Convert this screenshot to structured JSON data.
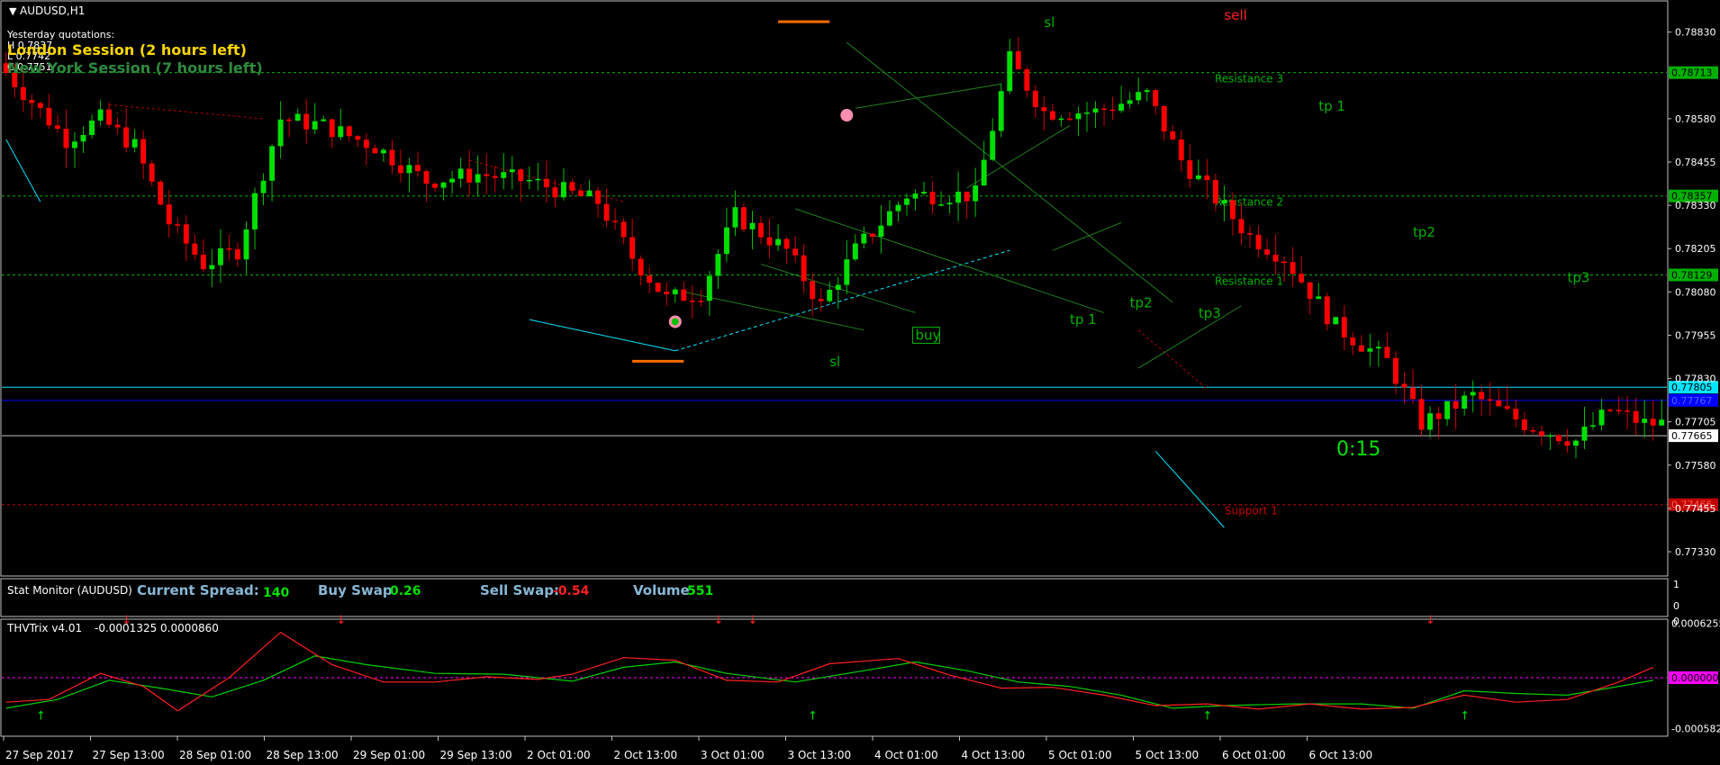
{
  "window": {
    "title": "AUDUSD,H1"
  },
  "overlay": {
    "yesterday_label": "Yesterday quotations:",
    "yesterday_lines": [
      "H 0.7837",
      "L 0.7742",
      "C 0.7751"
    ],
    "london_session": "London Session (2 hours left)",
    "newyork_session": "New York Session (7 hours left)"
  },
  "colors": {
    "background": "#000000",
    "bull": "#00e000",
    "bear": "#ff0000",
    "wick_bull": "#00c000",
    "wick_bear": "#d00000",
    "cyan": "#00e5ff",
    "blue": "#0000ff",
    "resistance": "#00b000",
    "support": "#c00000",
    "order_line": "#ff6a00",
    "gray_line": "#c0c0c0",
    "trix_main": "#00d000",
    "trix_signal": "#ff2020",
    "trix_zero": "#ff00ff",
    "stat_label": "#87b8d6"
  },
  "chart_data": [
    {
      "type": "candlestick",
      "symbol": "AUDUSD",
      "timeframe": "H1",
      "ylim": [
        0.7726,
        0.7892
      ],
      "yticks": [
        "0.78830",
        "0.78580",
        "0.78455",
        "0.78330",
        "0.78205",
        "0.78080",
        "0.77955",
        "0.77830",
        "0.77705",
        "0.77580",
        "0.77455",
        "0.77330"
      ],
      "x_labels": [
        "27 Sep 2017",
        "27 Sep 13:00",
        "28 Sep 01:00",
        "28 Sep 13:00",
        "29 Sep 01:00",
        "29 Sep 13:00",
        "2 Oct 01:00",
        "2 Oct 13:00",
        "3 Oct 01:00",
        "3 Oct 13:00",
        "4 Oct 01:00",
        "4 Oct 13:00",
        "5 Oct 01:00",
        "5 Oct 13:00",
        "6 Oct 01:00",
        "6 Oct 13:00"
      ],
      "waypoints": [
        [
          0,
          0.7874
        ],
        [
          8,
          0.7852
        ],
        [
          12,
          0.7858
        ],
        [
          16,
          0.785
        ],
        [
          20,
          0.7828
        ],
        [
          24,
          0.7816
        ],
        [
          28,
          0.782
        ],
        [
          33,
          0.7858
        ],
        [
          38,
          0.7856
        ],
        [
          44,
          0.785
        ],
        [
          50,
          0.784
        ],
        [
          56,
          0.7842
        ],
        [
          62,
          0.784
        ],
        [
          70,
          0.7834
        ],
        [
          74,
          0.7818
        ],
        [
          78,
          0.7806
        ],
        [
          82,
          0.7808
        ],
        [
          86,
          0.783
        ],
        [
          92,
          0.782
        ],
        [
          96,
          0.7804
        ],
        [
          100,
          0.782
        ],
        [
          106,
          0.7836
        ],
        [
          114,
          0.7836
        ],
        [
          118,
          0.7875
        ],
        [
          122,
          0.786
        ],
        [
          128,
          0.786
        ],
        [
          134,
          0.7865
        ],
        [
          138,
          0.7846
        ],
        [
          146,
          0.7824
        ],
        [
          150,
          0.7818
        ],
        [
          156,
          0.7798
        ],
        [
          162,
          0.7788
        ],
        [
          166,
          0.777
        ],
        [
          172,
          0.7778
        ],
        [
          178,
          0.777
        ],
        [
          184,
          0.7765
        ],
        [
          188,
          0.7774
        ],
        [
          192,
          0.777
        ]
      ],
      "price_levels": [
        {
          "label": "Resistance 3",
          "value": "0.78713",
          "price": 0.78713,
          "kind": "resistance"
        },
        {
          "label": "Resistance 2",
          "value": "0.78357",
          "price": 0.78357,
          "kind": "resistance"
        },
        {
          "label": "Resistance 1",
          "value": "0.78129",
          "price": 0.78129,
          "kind": "resistance"
        },
        {
          "label": "",
          "value": "0.77805",
          "price": 0.77805,
          "kind": "cyan"
        },
        {
          "label": "",
          "value": "0.77767",
          "price": 0.77767,
          "kind": "blue"
        },
        {
          "label": "",
          "value": "0.77665",
          "price": 0.77665,
          "kind": "current"
        },
        {
          "label": "Support 1",
          "value": "0.77466",
          "price": 0.77466,
          "kind": "support"
        }
      ],
      "annotations": [
        {
          "text": "sl",
          "bar": 96,
          "price": 0.77865,
          "color": "#00b000"
        },
        {
          "text": "buy",
          "bar": 106,
          "price": 0.77942,
          "color": "#00b000",
          "boxed": true
        },
        {
          "text": "tp 1",
          "bar": 124,
          "price": 0.77987,
          "color": "#00b000"
        },
        {
          "text": "tp2",
          "bar": 131,
          "price": 0.78036,
          "color": "#00b000"
        },
        {
          "text": "tp3",
          "bar": 139,
          "price": 0.78006,
          "color": "#00b000"
        },
        {
          "text": "sl",
          "bar": 121,
          "price": 0.78845,
          "color": "#00b000"
        },
        {
          "text": "sell",
          "bar": 142,
          "price": 0.78865,
          "color": "#ff2020"
        },
        {
          "text": "tp 1",
          "bar": 153,
          "price": 0.78603,
          "color": "#00b000"
        },
        {
          "text": "tp2",
          "bar": 164,
          "price": 0.7824,
          "color": "#00b000"
        },
        {
          "text": "tp3",
          "bar": 182,
          "price": 0.78108,
          "color": "#00b000"
        }
      ],
      "countdown": "0:15"
    },
    {
      "type": "line",
      "indicator": "THVTrix v4.01",
      "values_label": "-0.0001325 0.0000860",
      "yticks": [
        "0.0006255",
        "0.000000",
        "-0.0005824"
      ],
      "ylim": [
        -0.00066,
        0.00066
      ],
      "main_waypoints": [
        [
          0,
          -0.00028
        ],
        [
          5,
          -0.00025
        ],
        [
          11,
          5e-05
        ],
        [
          16,
          -0.0001
        ],
        [
          20,
          -0.00038
        ],
        [
          26,
          0
        ],
        [
          32,
          0.00052
        ],
        [
          38,
          0.00015
        ],
        [
          44,
          -5e-05
        ],
        [
          50,
          -5e-05
        ],
        [
          56,
          1e-05
        ],
        [
          62,
          -2e-05
        ],
        [
          66,
          4e-05
        ],
        [
          72,
          0.00023
        ],
        [
          78,
          0.0002
        ],
        [
          84,
          -3e-05
        ],
        [
          90,
          -5e-05
        ],
        [
          96,
          0.00016
        ],
        [
          104,
          0.00022
        ],
        [
          110,
          3e-05
        ],
        [
          116,
          -0.00012
        ],
        [
          122,
          -0.00011
        ],
        [
          128,
          -0.0002
        ],
        [
          134,
          -0.00032
        ],
        [
          140,
          -0.0003
        ],
        [
          146,
          -0.00036
        ],
        [
          152,
          -0.0003
        ],
        [
          158,
          -0.00036
        ],
        [
          164,
          -0.00034
        ],
        [
          170,
          -0.0002
        ],
        [
          176,
          -0.00028
        ],
        [
          182,
          -0.00025
        ],
        [
          188,
          -5e-05
        ],
        [
          192,
          0.00012
        ]
      ],
      "signal_waypoints": [
        [
          0,
          -0.00035
        ],
        [
          6,
          -0.00025
        ],
        [
          12,
          -3e-05
        ],
        [
          18,
          -0.00012
        ],
        [
          24,
          -0.00022
        ],
        [
          30,
          -3e-05
        ],
        [
          36,
          0.00025
        ],
        [
          42,
          0.00015
        ],
        [
          50,
          5e-05
        ],
        [
          58,
          4e-05
        ],
        [
          66,
          -4e-05
        ],
        [
          72,
          0.00012
        ],
        [
          78,
          0.00018
        ],
        [
          84,
          5e-05
        ],
        [
          92,
          -5e-05
        ],
        [
          100,
          8e-05
        ],
        [
          106,
          0.00018
        ],
        [
          112,
          8e-05
        ],
        [
          118,
          -5e-05
        ],
        [
          124,
          -0.0001
        ],
        [
          130,
          -0.0002
        ],
        [
          136,
          -0.00035
        ],
        [
          142,
          -0.00032
        ],
        [
          150,
          -0.0003
        ],
        [
          158,
          -0.0003
        ],
        [
          164,
          -0.00035
        ],
        [
          170,
          -0.00015
        ],
        [
          176,
          -0.00018
        ],
        [
          182,
          -0.0002
        ],
        [
          188,
          -0.0001
        ],
        [
          192,
          -3e-05
        ]
      ],
      "down_arrows": [
        14,
        39,
        83,
        87,
        166
      ],
      "up_arrows": [
        4,
        94,
        140,
        170
      ]
    }
  ],
  "stat_monitor": {
    "title": "Stat Monitor (AUDUSD)",
    "spread_label": "Current Spread:",
    "spread_value": "140",
    "buy_swap_label": "Buy Swap",
    "buy_swap_value": "0.26",
    "sell_swap_label": "Sell Swap:",
    "sell_swap_value": "-0.54",
    "volume_label": "Volume",
    "volume_value": "551",
    "axis_top": "1",
    "axis_mid": "0",
    "axis_bottom": "0"
  }
}
